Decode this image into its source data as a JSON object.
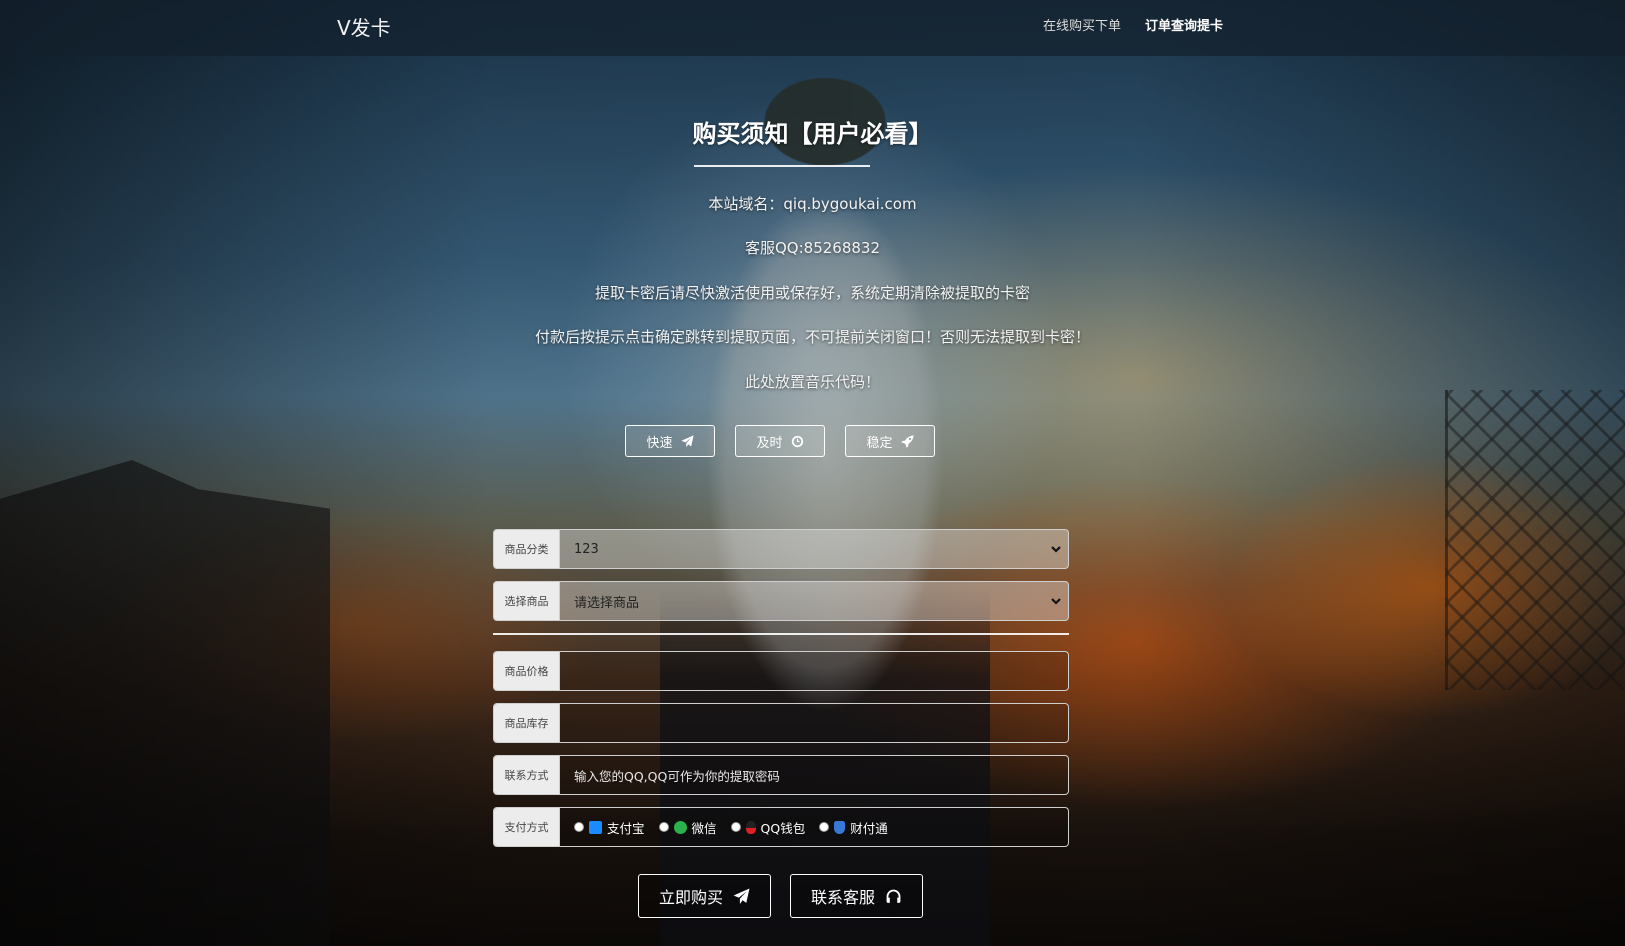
{
  "header": {
    "brand": "V发卡",
    "nav": [
      {
        "label": "在线购买下单",
        "active": false
      },
      {
        "label": "订单查询提卡",
        "active": true
      }
    ]
  },
  "notice": {
    "title": "购买须知【用户必看】",
    "lines": [
      "本站域名：qiq.bygoukai.com",
      "客服QQ:85268832",
      "提取卡密后请尽快激活使用或保存好，系统定期清除被提取的卡密",
      "付款后按提示点击确定跳转到提取页面，不可提前关闭窗口！否则无法提取到卡密！",
      "此处放置音乐代码！"
    ],
    "badges": [
      {
        "label": "快速",
        "icon": "paper-plane-icon"
      },
      {
        "label": "及时",
        "icon": "clock-icon"
      },
      {
        "label": "稳定",
        "icon": "rocket-icon"
      }
    ]
  },
  "form": {
    "category": {
      "label": "商品分类",
      "value": "123"
    },
    "product": {
      "label": "选择商品",
      "value": "请选择商品"
    },
    "price": {
      "label": "商品价格",
      "value": ""
    },
    "stock": {
      "label": "商品库存",
      "value": ""
    },
    "contact": {
      "label": "联系方式",
      "placeholder": "输入您的QQ,QQ可作为你的提取密码"
    },
    "payment": {
      "label": "支付方式",
      "options": [
        {
          "label": "支付宝",
          "icon": "alipay-icon",
          "color": "#1a8cff"
        },
        {
          "label": "微信",
          "icon": "wechat-icon",
          "color": "#2bb24c"
        },
        {
          "label": "QQ钱包",
          "icon": "qq-wallet-icon",
          "color": "#e02020"
        },
        {
          "label": "财付通",
          "icon": "tenpay-icon",
          "color": "#3a78d6"
        }
      ]
    }
  },
  "actions": {
    "buy": "立即购买",
    "contact": "联系客服"
  }
}
